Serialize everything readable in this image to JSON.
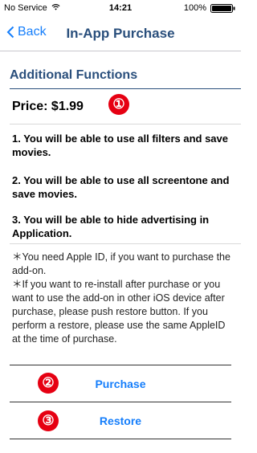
{
  "status_bar": {
    "carrier": "No Service",
    "time": "14:21",
    "battery": "100%"
  },
  "nav": {
    "back_label": "Back",
    "title": "In-App Purchase"
  },
  "section": {
    "header": "Additional Functions"
  },
  "price": {
    "label": "Price: $1.99"
  },
  "callouts": [
    "①",
    "②",
    "③"
  ],
  "features": [
    "1. You will be able to use all filters and save movies.",
    "2. You will be able to use all screentone and save movies.",
    "3. You will be able to hide advertising in Application."
  ],
  "notes": [
    "＊You need Apple ID, if you want to purchase the add-on.",
    "＊If you want to re-install after purchase or you want to use the add-on in other iOS device  after purchase, please push restore button. If you perform a restore, please use the same AppleID at the time of purchase."
  ],
  "actions": {
    "purchase_label": "Purchase",
    "restore_label": "Restore"
  },
  "colors": {
    "tint": "#157efb",
    "header": "#2a4f7c",
    "callout": "#e60012"
  },
  "icons": {
    "wifi": "wifi-icon",
    "battery": "battery-icon",
    "back": "chevron-left-icon"
  }
}
